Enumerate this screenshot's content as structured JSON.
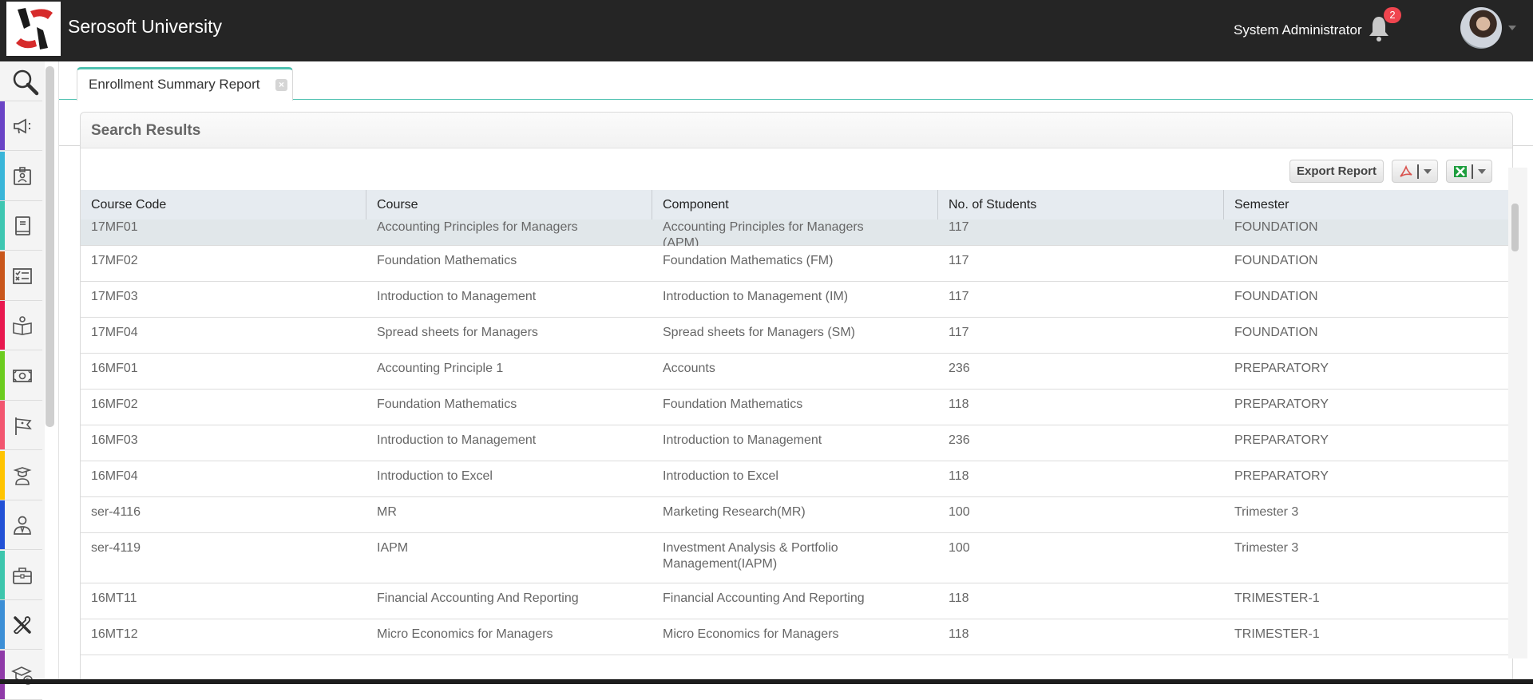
{
  "header": {
    "app_title": "Serosoft University",
    "user_name": "System Administrator",
    "notification_count": "2",
    "logo_colors": {
      "red": "#d62b2b",
      "black": "#1a1a1a"
    }
  },
  "sidebar": {
    "items": [
      {
        "icon": "search-icon",
        "accent": ""
      },
      {
        "icon": "megaphone-icon",
        "accent": "#6a44c6"
      },
      {
        "icon": "id-badge-icon",
        "accent": "#3ab6d9"
      },
      {
        "icon": "book-icon",
        "accent": "#3fc7b2"
      },
      {
        "icon": "checklist-icon",
        "accent": "#c9561b"
      },
      {
        "icon": "reader-icon",
        "accent": "#e8184f"
      },
      {
        "icon": "money-icon",
        "accent": "#6ccc1f"
      },
      {
        "icon": "flag-icon",
        "accent": "#f25670"
      },
      {
        "icon": "graduate-icon",
        "accent": "#ffc400"
      },
      {
        "icon": "staff-icon",
        "accent": "#2251d6"
      },
      {
        "icon": "briefcase-icon",
        "accent": "#3dc6ad"
      },
      {
        "icon": "tools-icon",
        "accent": "#3c8fd6"
      },
      {
        "icon": "scholarship-icon",
        "accent": "#8f3aa8"
      }
    ]
  },
  "tabs": [
    {
      "label": "Enrollment Summary Report",
      "close": "×",
      "active": true,
      "accent": "#4fc1b0"
    }
  ],
  "panel": {
    "title": "Search Results",
    "export_label": "Export Report",
    "pdf_icon": "pdf-icon",
    "excel_icon": "excel-icon"
  },
  "table": {
    "columns": [
      "Course Code",
      "Course",
      "Component",
      "No. of Students",
      "Semester"
    ],
    "rows": [
      [
        "17MF01",
        "Accounting Principles for Managers",
        "Accounting Principles for Managers (APM)",
        "117",
        "FOUNDATION"
      ],
      [
        "17MF02",
        "Foundation Mathematics",
        "Foundation Mathematics (FM)",
        "117",
        "FOUNDATION"
      ],
      [
        "17MF03",
        "Introduction to Management",
        "Introduction to Management (IM)",
        "117",
        "FOUNDATION"
      ],
      [
        "17MF04",
        "Spread sheets for Managers",
        "Spread sheets for Managers (SM)",
        "117",
        "FOUNDATION"
      ],
      [
        "16MF01",
        "Accounting Principle 1",
        "Accounts",
        "236",
        "PREPARATORY"
      ],
      [
        "16MF02",
        "Foundation Mathematics",
        "Foundation Mathematics",
        "118",
        "PREPARATORY"
      ],
      [
        "16MF03",
        "Introduction to Management",
        "Introduction to Management",
        "236",
        "PREPARATORY"
      ],
      [
        "16MF04",
        "Introduction to Excel",
        "Introduction to Excel",
        "118",
        "PREPARATORY"
      ],
      [
        "ser-4116",
        "MR",
        "Marketing Research(MR)",
        "100",
        "Trimester 3"
      ],
      [
        "ser-4119",
        "IAPM",
        "Investment Analysis & Portfolio Management(IAPM)",
        "100",
        "Trimester 3"
      ],
      [
        "16MT11",
        "Financial Accounting And Reporting",
        "Financial Accounting And Reporting",
        "118",
        "TRIMESTER-1"
      ],
      [
        "16MT12",
        "Micro Economics for Managers",
        "Micro Economics for Managers",
        "118",
        "TRIMESTER-1"
      ]
    ],
    "selected_row": 0
  }
}
